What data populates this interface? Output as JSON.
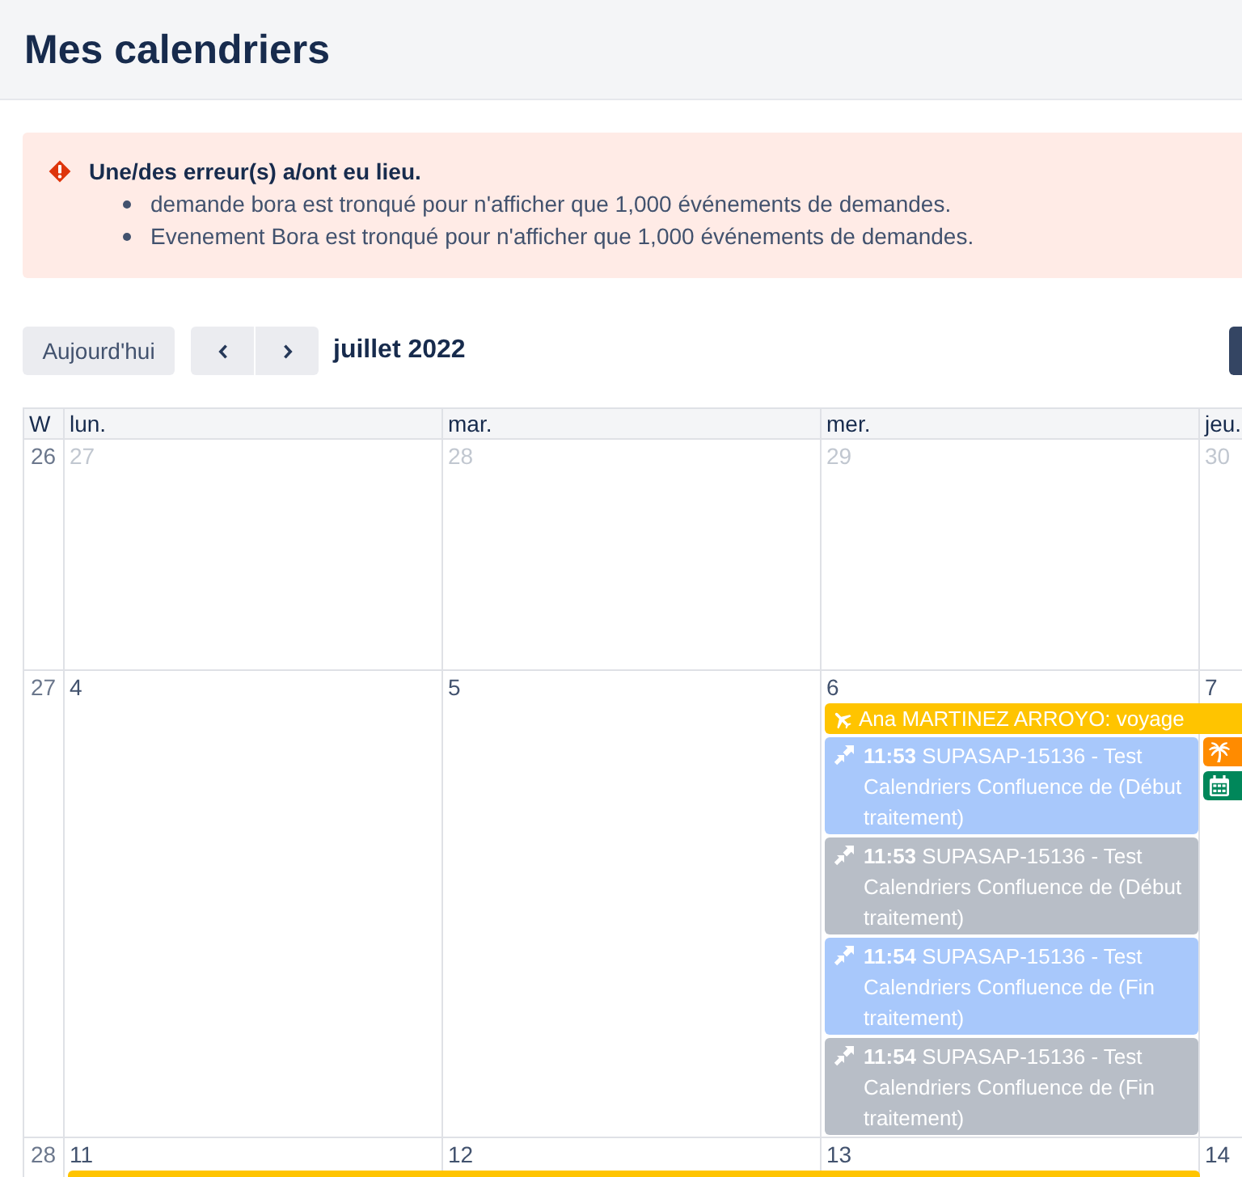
{
  "header": {
    "title": "Mes calendriers"
  },
  "error": {
    "title": "Une/des erreur(s) a/ont eu lieu.",
    "items": [
      "demande bora est tronqué pour n'afficher que 1,000 événements de demandes.",
      "Evenement Bora est tronqué pour n'afficher que 1,000 événements de demandes."
    ]
  },
  "toolbar": {
    "today": "Aujourd'hui",
    "period": "juillet 2022"
  },
  "calendar": {
    "columns": [
      "W",
      "lun.",
      "mar.",
      "mer.",
      "jeu."
    ],
    "weeks": [
      {
        "week": "26",
        "days": [
          {
            "date": "27",
            "other_month": true
          },
          {
            "date": "28",
            "other_month": true
          },
          {
            "date": "29",
            "other_month": true
          },
          {
            "date": "30",
            "other_month": true
          }
        ]
      },
      {
        "week": "27",
        "bars": [
          {
            "kind": "travel",
            "title": "Ana MARTINEZ ARROYO: voyage",
            "color": "#ffc400",
            "covers": [
              false,
              false,
              true,
              true
            ]
          }
        ],
        "days": [
          {
            "date": "4",
            "other_month": false
          },
          {
            "date": "5",
            "other_month": false
          },
          {
            "date": "6",
            "other_month": false,
            "events": [
              {
                "kind": "request",
                "time": "11:53",
                "title": "SUPASAP-15136 - Test Calendriers Confluence de (Début traitement)",
                "color": "#a8c8fb"
              },
              {
                "kind": "request",
                "time": "11:53",
                "title": "SUPASAP-15136 - Test Calendriers Confluence de (Début traitement)",
                "color": "#b8bec7"
              },
              {
                "kind": "request",
                "time": "11:54",
                "title": "SUPASAP-15136 - Test Calendriers Confluence de (Fin traitement)",
                "color": "#a8c8fb"
              },
              {
                "kind": "request",
                "time": "11:54",
                "title": "SUPASAP-15136 - Test Calendriers Confluence de (Fin traitement)",
                "color": "#b8bec7"
              }
            ]
          },
          {
            "date": "7",
            "other_month": false,
            "events": [
              {
                "kind": "vacation",
                "color": "#ff8b00"
              },
              {
                "kind": "meeting",
                "color": "#00875a"
              }
            ]
          }
        ]
      },
      {
        "week": "28",
        "bars": [
          {
            "color": "#ffc400",
            "covers": [
              true,
              true,
              true,
              false
            ]
          }
        ],
        "days": [
          {
            "date": "11",
            "other_month": false
          },
          {
            "date": "12",
            "other_month": false
          },
          {
            "date": "13",
            "other_month": false
          },
          {
            "date": "14",
            "other_month": false
          }
        ]
      }
    ]
  }
}
